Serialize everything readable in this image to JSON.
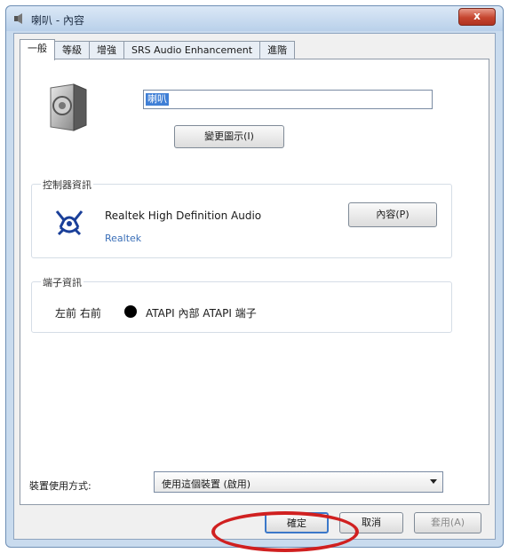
{
  "window": {
    "title": "喇叭 - 內容",
    "close_label": "x"
  },
  "tabs": [
    {
      "label": "一般",
      "active": true
    },
    {
      "label": "等級",
      "active": false
    },
    {
      "label": "增強",
      "active": false
    },
    {
      "label": "SRS Audio Enhancement",
      "active": false
    },
    {
      "label": "進階",
      "active": false
    }
  ],
  "device": {
    "icon": "speaker-icon",
    "name_value": "喇叭",
    "change_icon_label": "變更圖示(I)"
  },
  "controller_info": {
    "group_label": "控制器資訊",
    "icon": "realtek-logo-icon",
    "name": "Realtek High Definition Audio",
    "vendor": "Realtek",
    "properties_label": "內容(P)"
  },
  "jack_info": {
    "group_label": "端子資訊",
    "channels": "左前 右前",
    "jack_color": "#000000",
    "jack_name": "ATAPI 內部 ATAPI 端子"
  },
  "device_usage": {
    "label": "裝置使用方式:",
    "selected": "使用這個裝置 (啟用)"
  },
  "buttons": {
    "ok_label": "確定",
    "cancel_label": "取消",
    "apply_label": "套用(A)"
  },
  "colors": {
    "highlight": "#d02020",
    "selection": "#3f7fd6"
  }
}
